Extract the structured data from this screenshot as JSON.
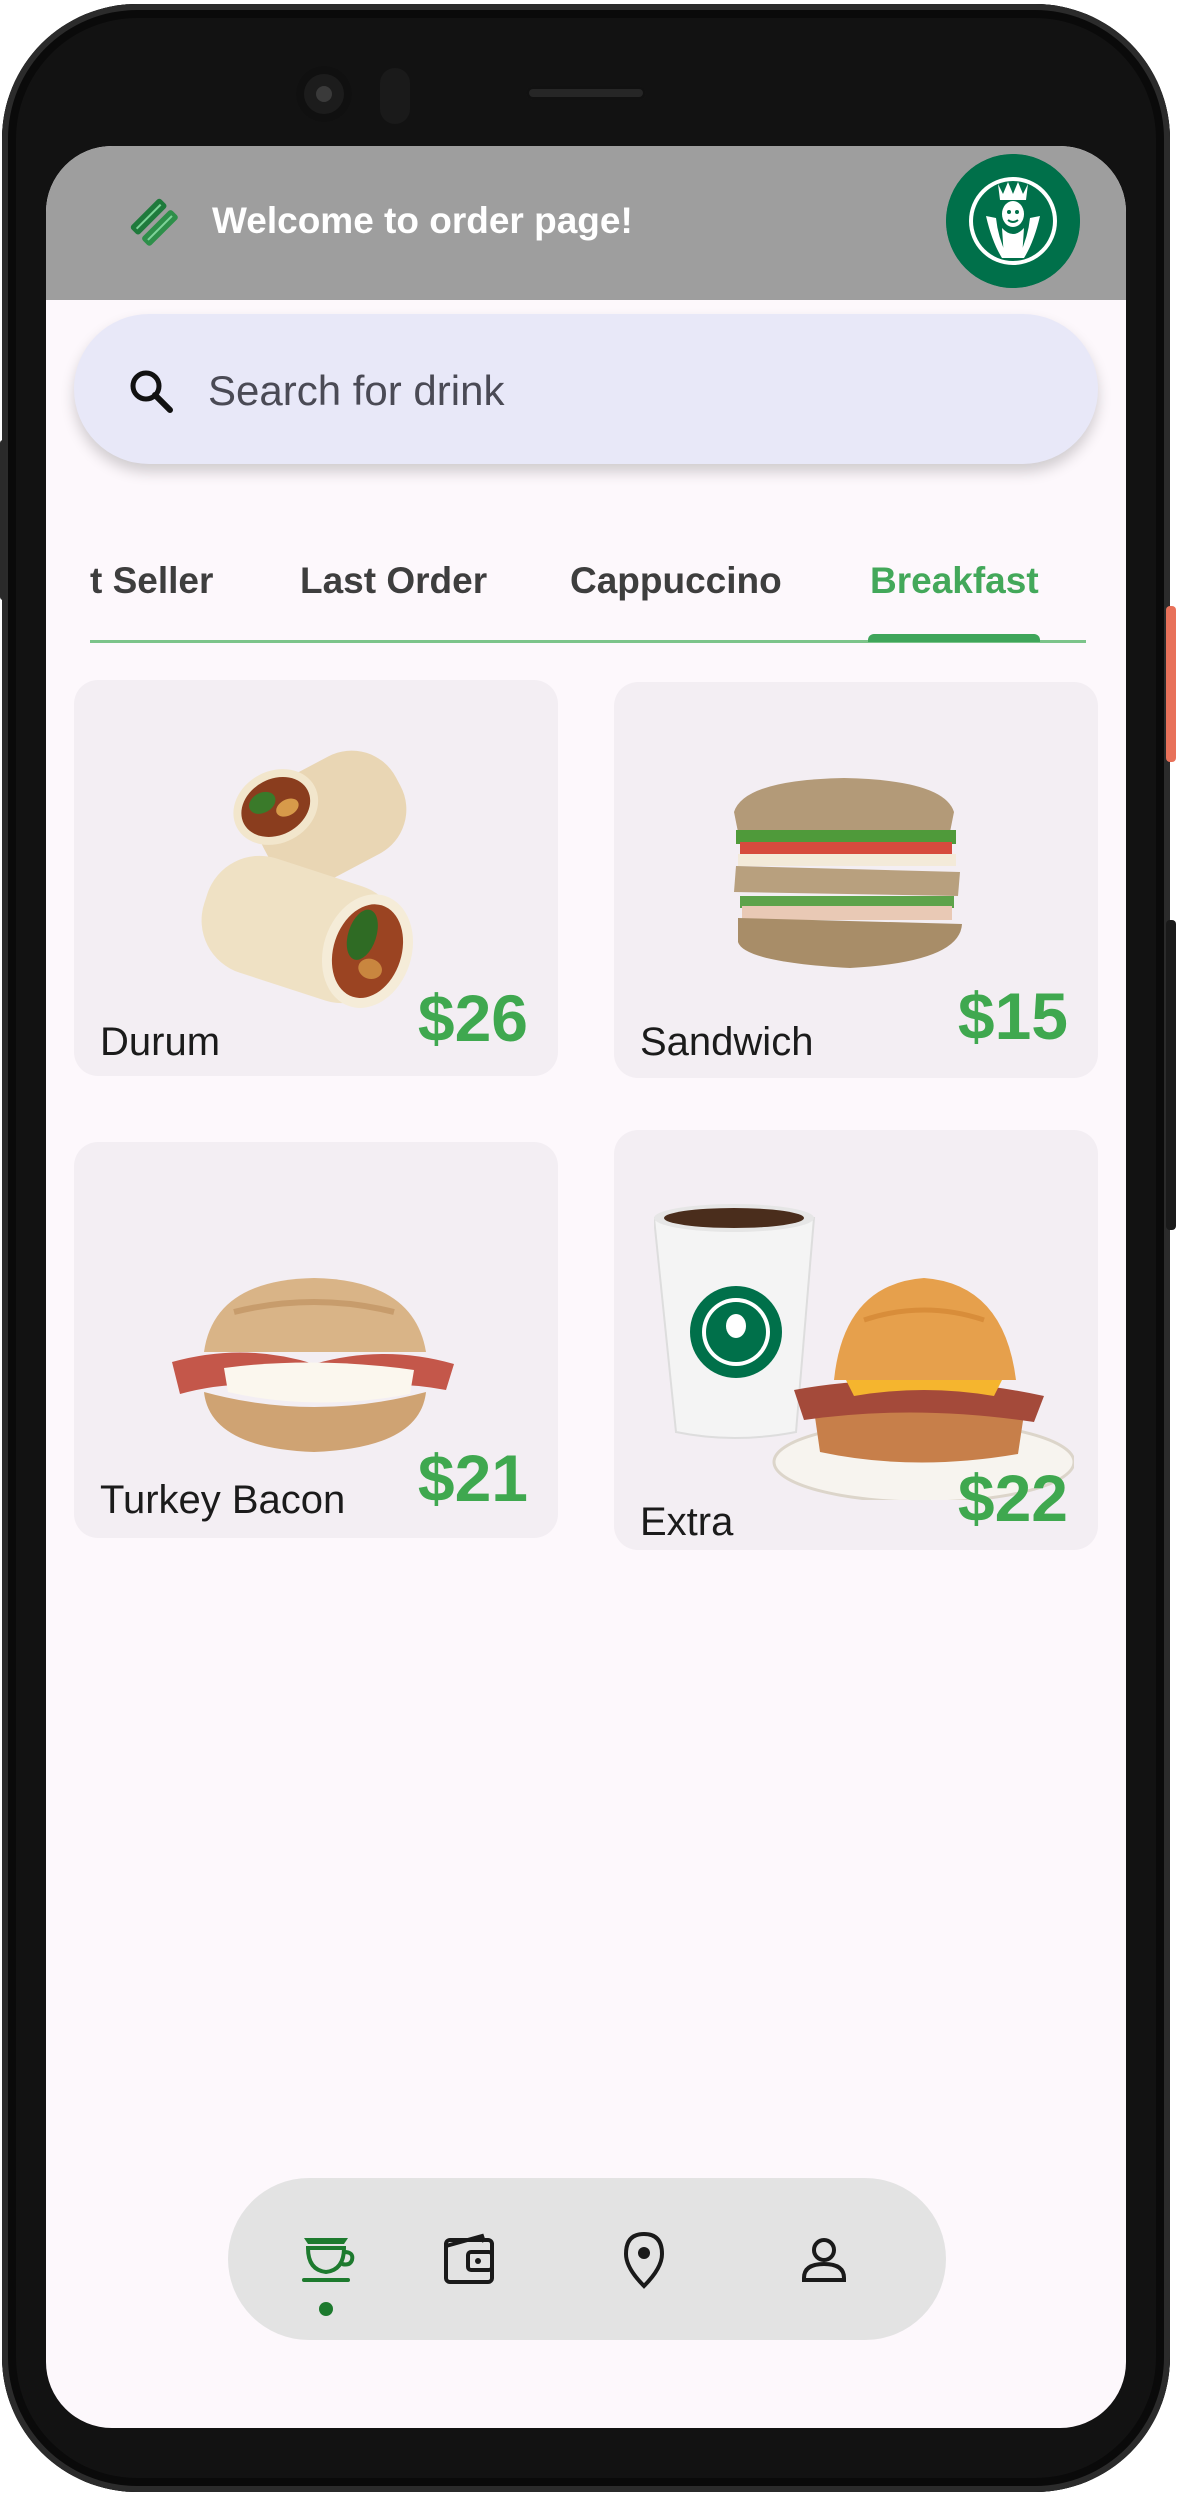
{
  "header": {
    "title": "Welcome to order page!"
  },
  "search": {
    "placeholder": "Search for drink",
    "value": ""
  },
  "tabs": [
    {
      "label": "t Seller",
      "active": false
    },
    {
      "label": "Last Order",
      "active": false
    },
    {
      "label": "Cappuccino",
      "active": false
    },
    {
      "label": "Breakfast",
      "active": true
    }
  ],
  "products": [
    {
      "name": "Durum",
      "price": "$26",
      "image": "durum-wrap"
    },
    {
      "name": "Sandwich",
      "price": "$15",
      "image": "sandwich"
    },
    {
      "name": "Turkey Bacon",
      "price": "$21",
      "image": "turkey-bacon-sandwich"
    },
    {
      "name": "Extra",
      "price": "$22",
      "image": "coffee-and-breakfast-sandwich"
    }
  ],
  "bottom_nav": [
    {
      "icon": "coffee-cup-icon",
      "active": true
    },
    {
      "icon": "wallet-icon",
      "active": false
    },
    {
      "icon": "location-pin-icon",
      "active": false
    },
    {
      "icon": "profile-icon",
      "active": false
    }
  ],
  "colors": {
    "accent": "#43a85a",
    "app_bar": "#9e9e9e",
    "price": "#3fa84f",
    "brand": "#00704a"
  }
}
